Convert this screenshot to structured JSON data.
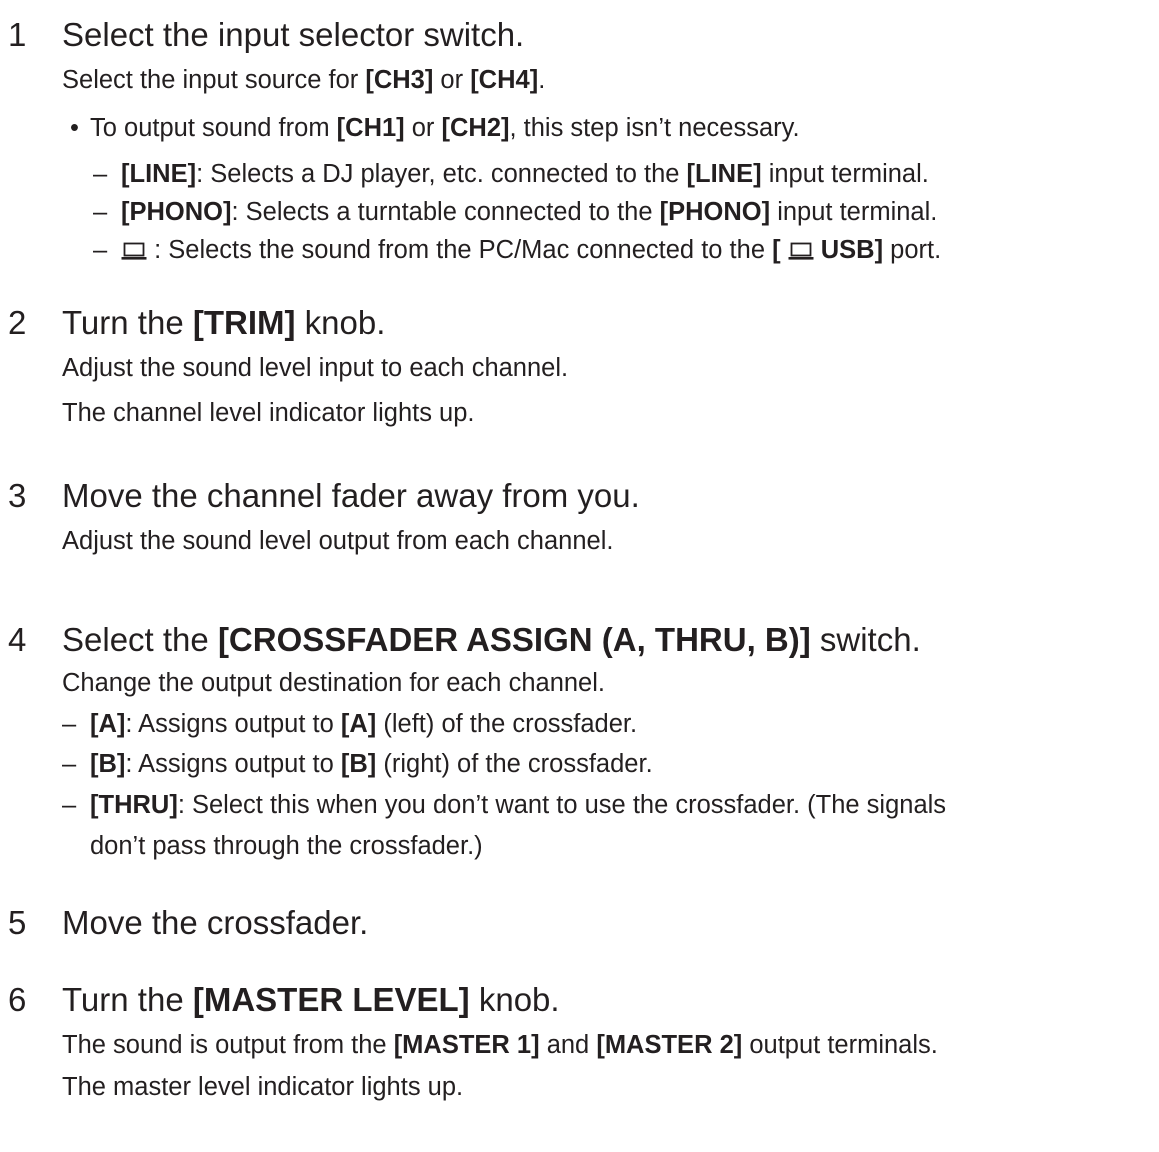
{
  "steps": [
    {
      "number": "1",
      "title_parts": [
        {
          "t": "Select the input selector switch.",
          "b": false
        }
      ],
      "lines": [
        {
          "kind": "desc",
          "parts": [
            {
              "t": "Select the input source for ",
              "b": false
            },
            {
              "t": "[CH3]",
              "b": true
            },
            {
              "t": " or ",
              "b": false
            },
            {
              "t": "[CH4]",
              "b": true
            },
            {
              "t": ".",
              "b": false
            }
          ]
        },
        {
          "kind": "bullet",
          "parts": [
            {
              "t": "To output sound from ",
              "b": false
            },
            {
              "t": "[CH1]",
              "b": true
            },
            {
              "t": " or ",
              "b": false
            },
            {
              "t": "[CH2]",
              "b": true
            },
            {
              "t": ", this step isn’t necessary.",
              "b": false
            }
          ]
        },
        {
          "kind": "dash",
          "parts": [
            {
              "t": "[LINE]",
              "b": true
            },
            {
              "t": ": Selects a DJ player, etc. connected to the ",
              "b": false
            },
            {
              "t": "[LINE]",
              "b": true
            },
            {
              "t": " input terminal.",
              "b": false
            }
          ]
        },
        {
          "kind": "dash",
          "parts": [
            {
              "t": "[PHONO]",
              "b": true
            },
            {
              "t": ": Selects a turntable connected to the ",
              "b": false
            },
            {
              "t": "[PHONO]",
              "b": true
            },
            {
              "t": " input terminal.",
              "b": false
            }
          ]
        },
        {
          "kind": "dash",
          "parts": [
            {
              "icon": "laptop-icon"
            },
            {
              "t": " : Selects the sound from the PC/Mac connected to the ",
              "b": false
            },
            {
              "t": "[ ",
              "b": true
            },
            {
              "icon": "laptop-icon"
            },
            {
              "t": " USB]",
              "b": true
            },
            {
              "t": " port.",
              "b": false
            }
          ]
        }
      ]
    },
    {
      "number": "2",
      "title_parts": [
        {
          "t": "Turn the ",
          "b": false
        },
        {
          "t": "[TRIM]",
          "b": true
        },
        {
          "t": " knob.",
          "b": false
        }
      ],
      "lines": [
        {
          "kind": "desc",
          "parts": [
            {
              "t": "Adjust the sound level input to each channel.",
              "b": false
            }
          ]
        },
        {
          "kind": "desc",
          "parts": [
            {
              "t": "The channel level indicator lights up.",
              "b": false
            }
          ]
        }
      ]
    },
    {
      "number": "3",
      "title_parts": [
        {
          "t": "Move the channel fader away from you.",
          "b": false
        }
      ],
      "lines": [
        {
          "kind": "desc",
          "parts": [
            {
              "t": "Adjust the sound level output from each channel.",
              "b": false
            }
          ]
        }
      ]
    },
    {
      "number": "4",
      "title_parts": [
        {
          "t": "Select the ",
          "b": false
        },
        {
          "t": "[CROSSFADER ASSIGN (A, THRU, B)]",
          "b": true
        },
        {
          "t": " switch.",
          "b": false
        }
      ],
      "lines": [
        {
          "kind": "desc",
          "parts": [
            {
              "t": "Change the output destination for each channel.",
              "b": false
            }
          ]
        },
        {
          "kind": "dash",
          "parts": [
            {
              "t": "[A]",
              "b": true
            },
            {
              "t": ": Assigns output to ",
              "b": false
            },
            {
              "t": "[A]",
              "b": true
            },
            {
              "t": " (left) of the crossfader.",
              "b": false
            }
          ]
        },
        {
          "kind": "dash",
          "parts": [
            {
              "t": "[B]",
              "b": true
            },
            {
              "t": ": Assigns output to ",
              "b": false
            },
            {
              "t": "[B]",
              "b": true
            },
            {
              "t": " (right) of the crossfader.",
              "b": false
            }
          ]
        },
        {
          "kind": "dash",
          "parts": [
            {
              "t": "[THRU]",
              "b": true
            },
            {
              "t": ": Select this when you don’t want to use the crossfader. (The signals",
              "b": false
            }
          ]
        },
        {
          "kind": "cont",
          "parts": [
            {
              "t": "don’t pass through the crossfader.)",
              "b": false
            }
          ]
        }
      ]
    },
    {
      "number": "5",
      "title_parts": [
        {
          "t": "Move the crossfader.",
          "b": false
        }
      ],
      "lines": []
    },
    {
      "number": "6",
      "title_parts": [
        {
          "t": "Turn the ",
          "b": false
        },
        {
          "t": "[MASTER LEVEL]",
          "b": true
        },
        {
          "t": " knob.",
          "b": false
        }
      ],
      "lines": [
        {
          "kind": "desc",
          "parts": [
            {
              "t": "The sound is output from the ",
              "b": false
            },
            {
              "t": "[MASTER 1]",
              "b": true
            },
            {
              "t": " and ",
              "b": false
            },
            {
              "t": "[MASTER 2]",
              "b": true
            },
            {
              "t": " output terminals.",
              "b": false
            }
          ]
        },
        {
          "kind": "desc",
          "parts": [
            {
              "t": "The master level indicator lights up.",
              "b": false
            }
          ]
        }
      ]
    }
  ]
}
